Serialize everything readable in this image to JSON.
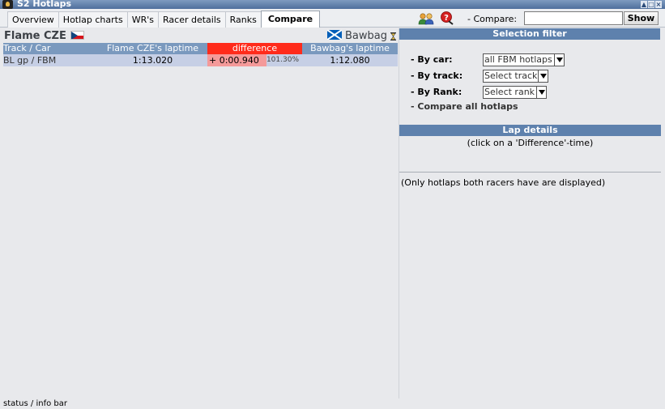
{
  "window": {
    "title": "S2 Hotlaps",
    "buttons": [
      "▲",
      "□",
      "×"
    ]
  },
  "tabs": [
    {
      "label": "Overview"
    },
    {
      "label": "Hotlap charts"
    },
    {
      "label": "WR's"
    },
    {
      "label": "Racer details"
    },
    {
      "label": "Ranks"
    },
    {
      "label": "Compare",
      "active": true
    }
  ],
  "toolbar": {
    "compare_label": "- Compare:",
    "compare_value": "",
    "show_label": "Show"
  },
  "comparison": {
    "racer1": {
      "name": "Flame CZE",
      "flag": "cz-flag-icon"
    },
    "racer2": {
      "name": "Bawbag",
      "flag": "scotland-flag-icon"
    },
    "columns": [
      "Track / Car",
      "Flame CZE's laptime",
      "difference",
      "Bawbag's laptime"
    ],
    "rows": [
      {
        "track_car": "BL gp / FBM",
        "racer1_time": "1:13.020",
        "difference": "+ 0:00.940",
        "percent": "101.30%",
        "racer2_time": "1:12.080"
      }
    ]
  },
  "filter": {
    "title": "Selection filter",
    "by_car_label": "- By car:",
    "by_car_value": "all FBM hotlaps",
    "by_track_label": "- By track:",
    "by_track_value": "Select track",
    "by_rank_label": "- By Rank:",
    "by_rank_value": "Select rank",
    "compare_all": "- Compare all hotlaps"
  },
  "lap_details": {
    "title": "Lap details",
    "hint": "(click on a 'Difference'-time)",
    "note": "(Only hotlaps both racers have are displayed)"
  },
  "status": {
    "text": "status / info bar"
  },
  "colors": {
    "header_blue": "#7a99be",
    "diff_red": "#ff2b1b",
    "row_bg": "#c6cfe5",
    "section_blue": "#5e81ad"
  }
}
